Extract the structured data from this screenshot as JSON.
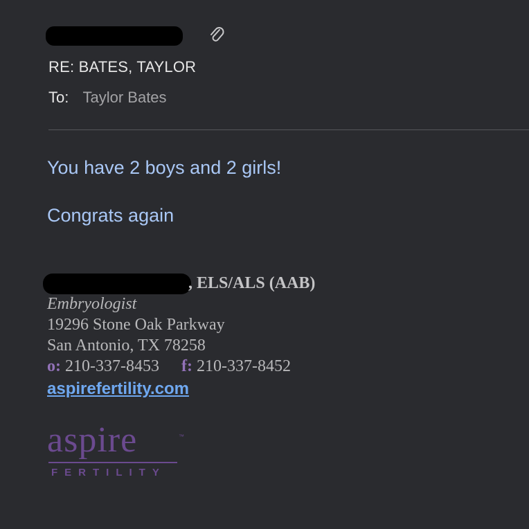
{
  "header": {
    "subject": "RE: BATES, TAYLOR",
    "to_label": "To:",
    "to_name": "Taylor Bates"
  },
  "icons": {
    "attachment": "paperclip-icon"
  },
  "body": {
    "line1": "You have 2 boys and 2 girls!",
    "line2": "Congrats again"
  },
  "signature": {
    "credentials": ", ELS/ALS (AAB)",
    "title": "Embryologist",
    "address_line1": "19296 Stone Oak Parkway",
    "address_line2": "San Antonio, TX 78258",
    "office_label": "o:",
    "office_phone": "210-337-8453",
    "fax_label": "f:",
    "fax_phone": "210-337-8452",
    "website": "aspirefertility.com"
  },
  "logo": {
    "word": "aspire",
    "sub": "FERTILITY",
    "tm": "™"
  },
  "colors": {
    "background": "#2a2b2f",
    "body_text": "#a9c7f5",
    "link": "#6fa8f0",
    "brand_purple": "#6b4a8f"
  }
}
